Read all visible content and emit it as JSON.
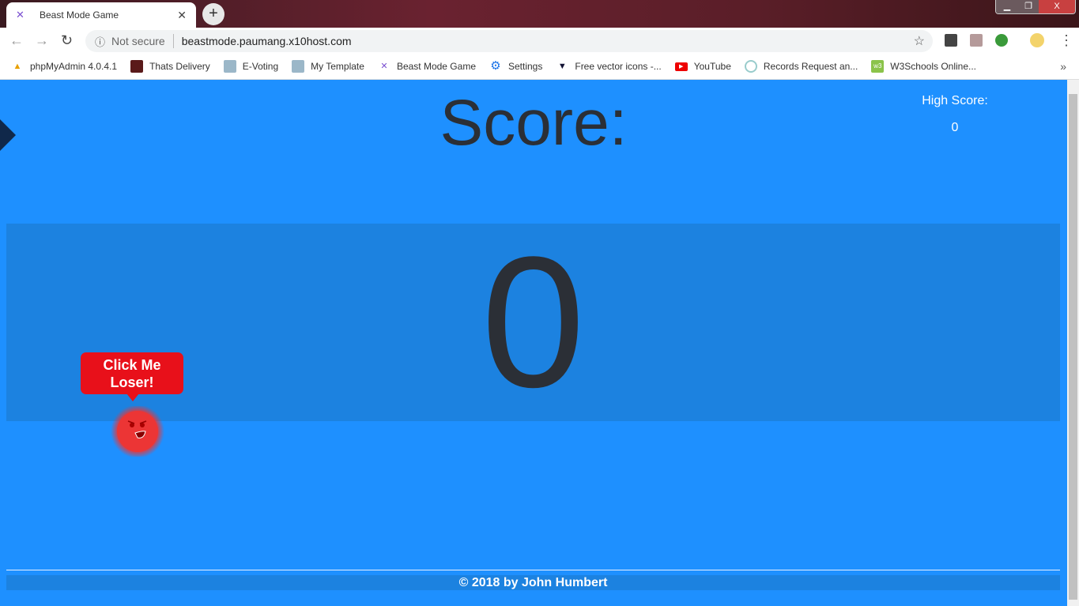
{
  "browser": {
    "tab_title": "Beast Mode Game",
    "security_label": "Not secure",
    "url": "beastmode.paumang.x10host.com",
    "bookmarks": [
      {
        "label": "phpMyAdmin 4.0.4.1",
        "icon": "pma-icon"
      },
      {
        "label": "Thats Delivery",
        "icon": "delivery-icon"
      },
      {
        "label": "E-Voting",
        "icon": "person-icon"
      },
      {
        "label": "My Template",
        "icon": "person-icon"
      },
      {
        "label": "Beast Mode Game",
        "icon": "beast-icon"
      },
      {
        "label": "Settings",
        "icon": "gear-icon"
      },
      {
        "label": "Free vector icons -...",
        "icon": "flaticon-icon"
      },
      {
        "label": "YouTube",
        "icon": "youtube-icon"
      },
      {
        "label": "Records Request an...",
        "icon": "seal-icon"
      },
      {
        "label": "W3Schools Online...",
        "icon": "w3schools-icon"
      }
    ],
    "more_bookmarks": "»"
  },
  "game": {
    "score_label": "Score:",
    "high_score_label": "High Score:",
    "high_score_value": "0",
    "score_value": "0",
    "bubble_text_line1": "Click Me",
    "bubble_text_line2": "Loser!",
    "footer": "© 2018 by John Humbert"
  },
  "colors": {
    "background": "#1e90ff",
    "panel": "#1c82e0",
    "bubble": "#e8101a",
    "text": "#2b2f36"
  }
}
